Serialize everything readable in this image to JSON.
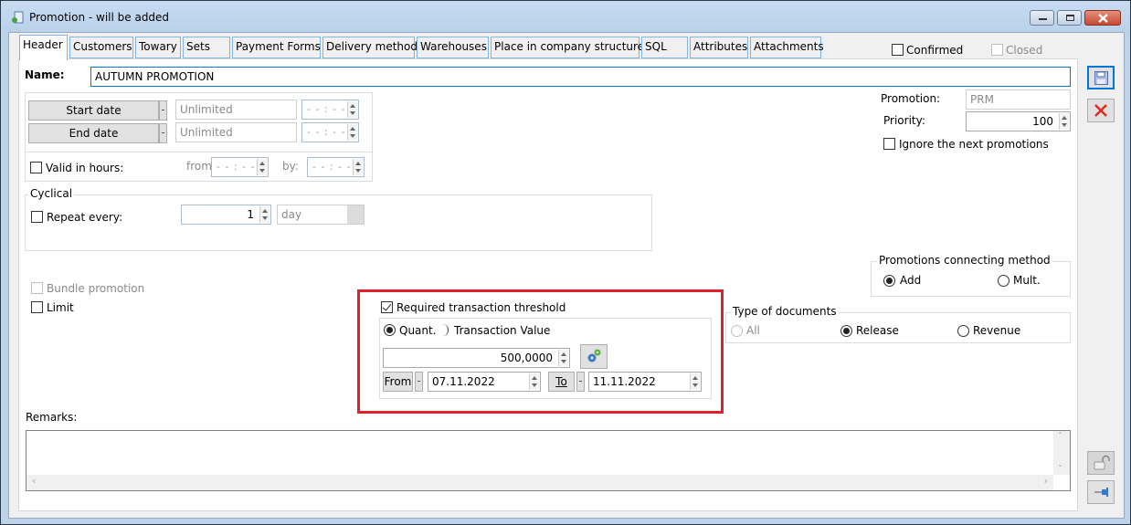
{
  "window": {
    "title": "Promotion - will be added",
    "controls": [
      "minimize",
      "maximize",
      "close"
    ]
  },
  "tabs": [
    {
      "label": "Header",
      "active": true
    },
    {
      "label": "Customers",
      "active": false
    },
    {
      "label": "Towary",
      "active": false
    },
    {
      "label": "Sets",
      "active": false
    },
    {
      "label": "Payment Forms",
      "active": false
    },
    {
      "label": "Delivery method",
      "active": false
    },
    {
      "label": "Warehouses",
      "active": false
    },
    {
      "label": "Place in company structure",
      "active": false
    },
    {
      "label": "SQL",
      "active": false
    },
    {
      "label": "Attributes",
      "active": false
    },
    {
      "label": "Attachments",
      "active": false
    }
  ],
  "status": {
    "confirmed": {
      "label": "Confirmed",
      "checked": false
    },
    "closed": {
      "label": "Closed",
      "checked": false,
      "disabled": true
    }
  },
  "name": {
    "label": "Name:",
    "value": "AUTUMN PROMOTION"
  },
  "dates": {
    "start_label": "Start date",
    "start_value": "Unlimited",
    "start_time": "- - : - -",
    "end_label": "End date",
    "end_value": "Unlimited",
    "end_time": "- - : - -",
    "valid_hours": {
      "label": "Valid in hours:",
      "checked": false
    },
    "from_label": "from",
    "from_time": "- - : - -",
    "by_label": "by:",
    "by_time": "- - : - -"
  },
  "cyclical": {
    "legend": "Cyclical",
    "repeat": {
      "label": "Repeat every:",
      "checked": false
    },
    "count": "1",
    "unit": "day"
  },
  "bundle_promotion": {
    "label": "Bundle promotion",
    "checked": false,
    "disabled": true
  },
  "limit": {
    "label": "Limit",
    "checked": false
  },
  "threshold": {
    "label": "Required transaction threshold",
    "checked": true,
    "mode_quant": {
      "label": "Quant.",
      "selected": true
    },
    "mode_value": {
      "label": "Transaction Value",
      "selected": false
    },
    "amount": "500,0000",
    "from_label": "From",
    "from_date": "07.11.2022",
    "to_label": "To",
    "to_date": "11.11.2022"
  },
  "promotion": {
    "code_label": "Promotion:",
    "code_value": "PRM",
    "priority_label": "Priority:",
    "priority_value": "100",
    "ignore_next": {
      "label": "Ignore the next promotions",
      "checked": false
    }
  },
  "connecting_method": {
    "legend": "Promotions connecting method",
    "options": [
      {
        "label": "Add",
        "selected": true
      },
      {
        "label": "Mult.",
        "selected": false
      }
    ]
  },
  "document_types": {
    "legend": "Type of documents",
    "options": [
      {
        "label": "All",
        "selected": false,
        "disabled": true
      },
      {
        "label": "Release",
        "selected": true
      },
      {
        "label": "Revenue",
        "selected": false
      }
    ]
  },
  "remarks": {
    "label": "Remarks:",
    "value": ""
  },
  "side_buttons": {
    "save": "save-icon",
    "cancel": "close-icon",
    "lock": "unlock-icon",
    "pin": "pin-icon"
  },
  "colors": {
    "highlight_border": "#e0202a",
    "accent": "#0078d7",
    "tab_border": "#7fb6e6"
  }
}
